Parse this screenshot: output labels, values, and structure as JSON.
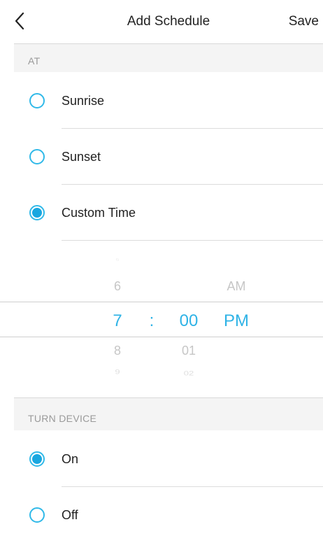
{
  "header": {
    "back_icon": "chevron-left-icon",
    "title": "Add Schedule",
    "save_label": "Save"
  },
  "at_section": {
    "header": "AT",
    "options": [
      {
        "label": "Sunrise",
        "selected": false
      },
      {
        "label": "Sunset",
        "selected": false
      },
      {
        "label": "Custom Time",
        "selected": true
      }
    ]
  },
  "time_picker": {
    "hour": {
      "selected": "7",
      "above": [
        "5",
        "6"
      ],
      "below": [
        "8",
        "9"
      ]
    },
    "separator": ":",
    "minute": {
      "selected": "00",
      "below": [
        "01",
        "02"
      ]
    },
    "period": {
      "selected": "PM",
      "above": [
        "AM"
      ]
    }
  },
  "turn_device_section": {
    "header": "TURN DEVICE",
    "options": [
      {
        "label": "On",
        "selected": true
      },
      {
        "label": "Off",
        "selected": false
      }
    ]
  },
  "colors": {
    "accent": "#1aa7e0",
    "picker_selected": "#2fb3e6",
    "section_bg": "#f4f4f4"
  }
}
